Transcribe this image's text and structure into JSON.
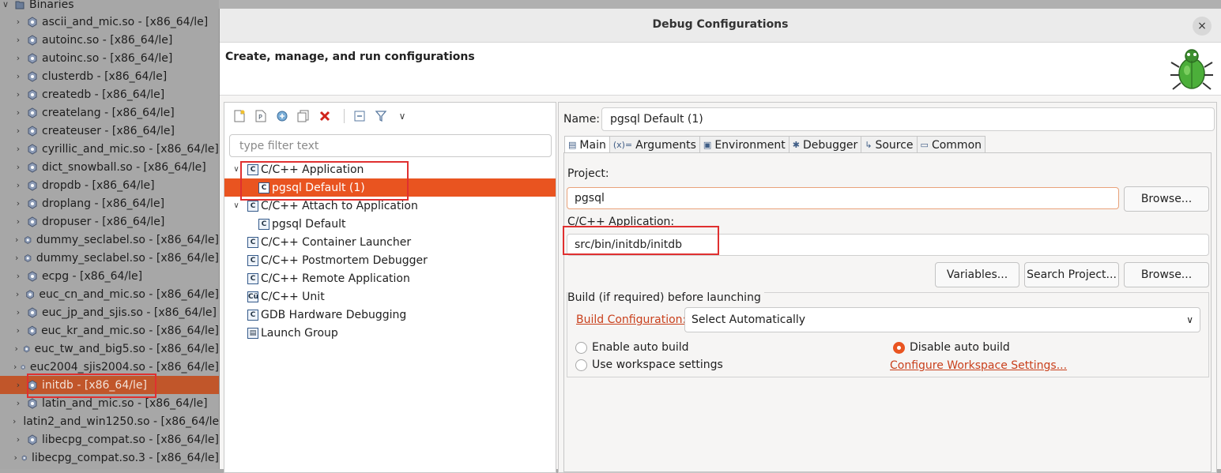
{
  "tree": {
    "root_label": "Binaries",
    "items": [
      "ascii_and_mic.so - [x86_64/le]",
      "autoinc.so - [x86_64/le]",
      "autoinc.so - [x86_64/le]",
      "clusterdb - [x86_64/le]",
      "createdb - [x86_64/le]",
      "createlang - [x86_64/le]",
      "createuser - [x86_64/le]",
      "cyrillic_and_mic.so - [x86_64/le]",
      "dict_snowball.so - [x86_64/le]",
      "dropdb - [x86_64/le]",
      "droplang - [x86_64/le]",
      "dropuser - [x86_64/le]",
      "dummy_seclabel.so - [x86_64/le]",
      "dummy_seclabel.so - [x86_64/le]",
      "ecpg - [x86_64/le]",
      "euc_cn_and_mic.so - [x86_64/le]",
      "euc_jp_and_sjis.so - [x86_64/le]",
      "euc_kr_and_mic.so - [x86_64/le]",
      "euc_tw_and_big5.so - [x86_64/le]",
      "euc2004_sjis2004.so - [x86_64/le]",
      "initdb - [x86_64/le]",
      "latin_and_mic.so - [x86_64/le]",
      "latin2_and_win1250.so - [x86_64/le]",
      "libecpg_compat.so - [x86_64/le]",
      "libecpg_compat.so.3 - [x86_64/le]"
    ],
    "selected_index": 20
  },
  "dialog": {
    "title": "Debug Configurations",
    "close_symbol": "×",
    "header_title": "Create, manage, and run configurations"
  },
  "config_pane": {
    "filter_placeholder": "type filter text",
    "rows": [
      {
        "label": "C/C++ Application",
        "icon": "C",
        "chev": "∨",
        "child": false,
        "selected": false
      },
      {
        "label": "pgsql Default (1)",
        "icon": "C",
        "chev": "",
        "child": true,
        "selected": true
      },
      {
        "label": "C/C++ Attach to Application",
        "icon": "C",
        "chev": "∨",
        "child": false,
        "selected": false
      },
      {
        "label": "pgsql Default",
        "icon": "C",
        "chev": "",
        "child": true,
        "selected": false
      },
      {
        "label": "C/C++ Container Launcher",
        "icon": "C",
        "chev": "",
        "child": false,
        "selected": false
      },
      {
        "label": "C/C++ Postmortem Debugger",
        "icon": "C",
        "chev": "",
        "child": false,
        "selected": false
      },
      {
        "label": "C/C++ Remote Application",
        "icon": "C",
        "chev": "",
        "child": false,
        "selected": false
      },
      {
        "label": "C/C++ Unit",
        "icon": "Cü",
        "chev": "",
        "child": false,
        "selected": false
      },
      {
        "label": "GDB Hardware Debugging",
        "icon": "C",
        "chev": "",
        "child": false,
        "selected": false
      },
      {
        "label": "Launch Group",
        "icon": "▤",
        "chev": "",
        "child": false,
        "selected": false
      }
    ]
  },
  "main_pane": {
    "name_label": "Name:",
    "name_value": "pgsql Default (1)",
    "tabs": [
      {
        "label": "Main",
        "icon": "▤"
      },
      {
        "label": "Arguments",
        "icon": "(x)="
      },
      {
        "label": "Environment",
        "icon": "▣"
      },
      {
        "label": "Debugger",
        "icon": "✱"
      },
      {
        "label": "Source",
        "icon": "↳"
      },
      {
        "label": "Common",
        "icon": "▭"
      }
    ],
    "project_label": "Project:",
    "project_value": "pgsql",
    "browse_label": "Browse...",
    "app_label": "C/C++ Application:",
    "app_value": "src/bin/initdb/initdb",
    "variables_label": "Variables...",
    "search_project_label": "Search Project...",
    "build_group_label": "Build (if required) before launching",
    "build_config_link": "Build Configuration:",
    "build_config_value": "Select Automatically",
    "enable_auto_build": "Enable auto build",
    "disable_auto_build": "Disable auto build",
    "use_workspace_settings": "Use workspace settings",
    "configure_workspace_link": "Configure Workspace Settings...",
    "selected_build_option": "disable_auto_build"
  },
  "colors": {
    "selection_orange": "#e95420",
    "tree_selection": "#c1562a",
    "link": "#c9401c",
    "highlight_box": "#e03030"
  }
}
